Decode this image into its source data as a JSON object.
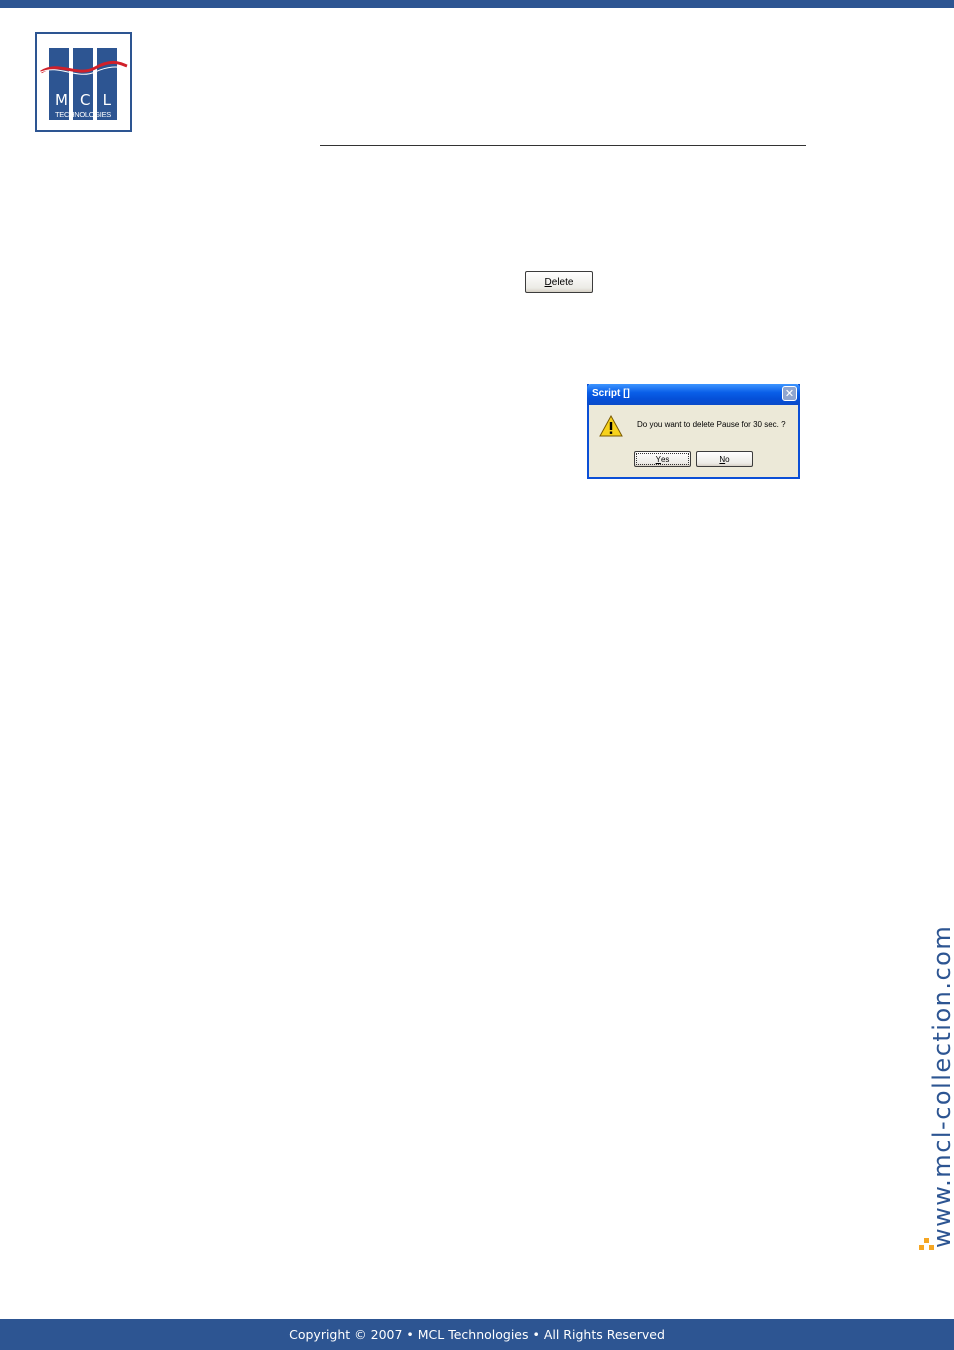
{
  "logo": {
    "letters": [
      "M",
      "C",
      "L"
    ],
    "subtitle": "TECHNOLOGIES"
  },
  "delete_button": {
    "label_mnemonic": "D",
    "label_rest": "elete"
  },
  "dialog": {
    "title": "Script []",
    "message": "Do you want to delete Pause for 30 sec. ?",
    "icon": "warning-icon",
    "close_icon": "close-icon",
    "close_glyph": "✕",
    "yes_mnemonic": "Y",
    "yes_rest": "es",
    "no_mnemonic": "N",
    "no_rest": "o"
  },
  "side_url": "www.mcl-collection.com",
  "footer": {
    "copyright": "Copyright © 2007 • MCL Technologies • All Rights Reserved"
  },
  "colors": {
    "brand_blue": "#2d5592",
    "logo_wave_red": "#d0202a",
    "accent_orange": "#f5a623"
  }
}
